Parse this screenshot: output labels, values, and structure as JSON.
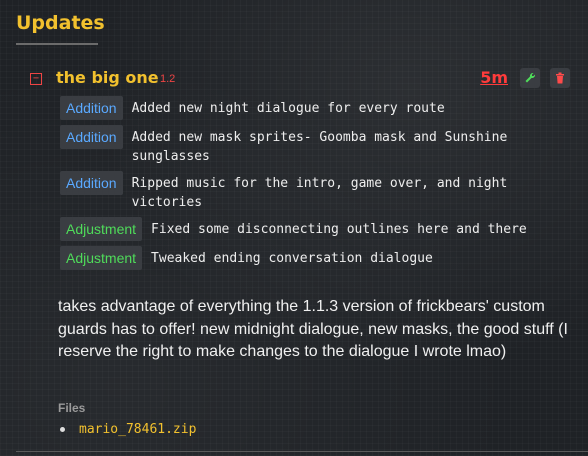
{
  "section": {
    "title": "Updates"
  },
  "version": {
    "name": "the big one",
    "number": "1.2",
    "time_ago": "5m",
    "collapse_symbol": "−"
  },
  "changes": [
    {
      "tag": "Addition",
      "text": "Added new night dialogue for every route"
    },
    {
      "tag": "Addition",
      "text": "Added new mask sprites- Goomba mask and Sunshine sunglasses"
    },
    {
      "tag": "Addition",
      "text": "Ripped music for the intro, game over, and night victories"
    },
    {
      "tag": "Adjustment",
      "text": "Fixed some disconnecting outlines here and there"
    },
    {
      "tag": "Adjustment",
      "text": "Tweaked ending conversation dialogue"
    }
  ],
  "description": "takes advantage of everything the 1.1.3 version of frickbears' custom guards has to offer! new midnight dialogue, new masks, the good stuff (I reserve the right to make changes to the dialogue I wrote lmao)",
  "files": {
    "label": "Files",
    "items": [
      "mario_78461.zip"
    ]
  },
  "colors": {
    "accent_yellow": "#f2c12e",
    "danger_red": "#ff3b3b",
    "addition_blue": "#5aa9ff",
    "adjustment_green": "#4fdc5a"
  },
  "icons": {
    "edit": "wrench-icon",
    "delete": "trash-icon",
    "collapse": "collapse-icon"
  }
}
